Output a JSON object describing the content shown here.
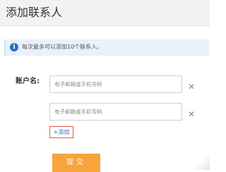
{
  "dialog": {
    "title": "添加联系人"
  },
  "notice": {
    "icon": "info-icon",
    "icon_glyph": "i",
    "text": "每次最多可以添加10个联系人。"
  },
  "form": {
    "account_label": "账户名:",
    "fields": [
      {
        "value": "",
        "placeholder": "电子邮箱或手机号码"
      },
      {
        "value": "",
        "placeholder": "电子邮箱或手机号码"
      }
    ],
    "remove_icon": "close-icon",
    "remove_glyph": "✕",
    "add_label": "+添加",
    "submit_label": "提交"
  },
  "colors": {
    "title_bar_bg": "#f2f2f2",
    "notice_bg": "#e9f1fa",
    "info_icon": "#2a6ebb",
    "link": "#2a6ebb",
    "add_border": "#e25b42",
    "submit_bg": "#f7a43d"
  }
}
